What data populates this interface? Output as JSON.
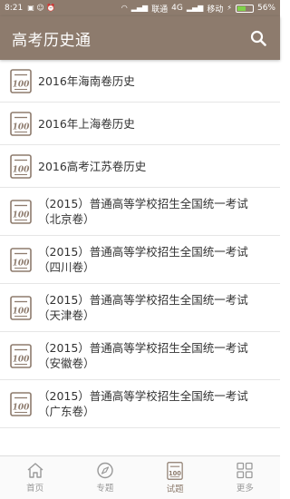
{
  "status_bar": {
    "time": "8:21",
    "carrier1": "联通",
    "network": "4G",
    "carrier2": "移动",
    "battery": "56%",
    "battery_level": 0.56
  },
  "app_bar": {
    "title": "高考历史通",
    "search_icon": "search-icon"
  },
  "items": [
    {
      "line1": "2016年海南卷历史",
      "line2": ""
    },
    {
      "line1": "2016年上海卷历史",
      "line2": ""
    },
    {
      "line1": "2016高考江苏卷历史",
      "line2": ""
    },
    {
      "line1": "（2015）普通高等学校招生全国统一考试",
      "line2": "（北京卷）"
    },
    {
      "line1": "（2015）普通高等学校招生全国统一考试",
      "line2": "（四川卷）"
    },
    {
      "line1": "（2015）普通高等学校招生全国统一考试",
      "line2": "（天津卷）"
    },
    {
      "line1": "（2015）普通高等学校招生全国统一考试",
      "line2": "（安徽卷）"
    },
    {
      "line1": "（2015）普通高等学校招生全国统一考试",
      "line2": "（广东卷）"
    }
  ],
  "doc_icon_text": "100",
  "tabs": [
    {
      "label": "首页",
      "icon": "home-icon"
    },
    {
      "label": "专题",
      "icon": "compass-icon"
    },
    {
      "label": "试题",
      "icon": "exam-doc-icon"
    },
    {
      "label": "更多",
      "icon": "grid-icon"
    }
  ],
  "colors": {
    "primary": "#8d7b6d",
    "active_tab": "#8d7b6d",
    "inactive_tab": "#999999"
  }
}
